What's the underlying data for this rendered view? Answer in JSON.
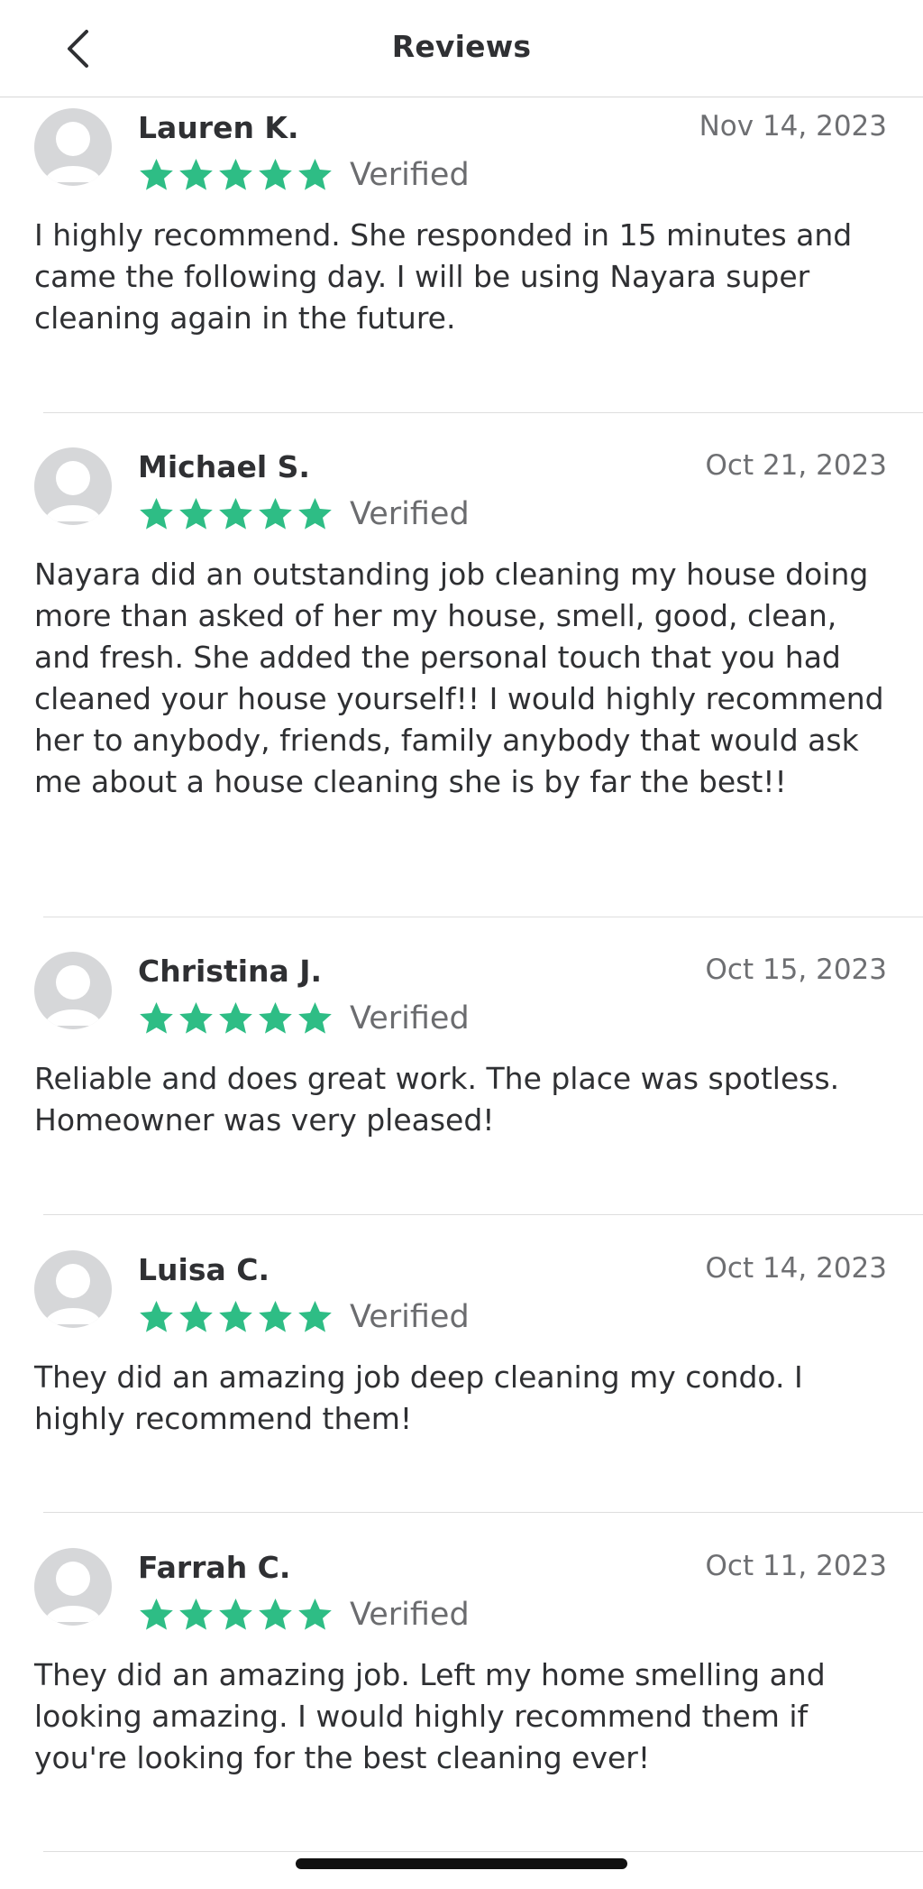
{
  "header": {
    "title": "Reviews"
  },
  "colors": {
    "star": "#2ebd85",
    "avatar": "#d6d7d9"
  },
  "reviews": [
    {
      "name": "Lauren K.",
      "date": "Nov 14, 2023",
      "rating": 5,
      "verified_label": "Verified",
      "text": "I highly recommend. She responded in 15 minutes and came the following day. I will be using Nayara super cleaning again in the future."
    },
    {
      "name": "Michael S.",
      "date": "Oct 21, 2023",
      "rating": 5,
      "verified_label": "Verified",
      "text": "Nayara did an outstanding job cleaning my house doing more than asked of her my house, smell, good, clean, and fresh. She added the personal touch that you had cleaned your house yourself!! I would highly recommend her to anybody, friends, family anybody that would ask me about a house cleaning she is by far the best!!"
    },
    {
      "name": "Christina J.",
      "date": "Oct 15, 2023",
      "rating": 5,
      "verified_label": "Verified",
      "text": "Reliable and does great work. The place was spotless. Homeowner was very pleased!"
    },
    {
      "name": "Luisa C.",
      "date": "Oct 14, 2023",
      "rating": 5,
      "verified_label": "Verified",
      "text": "They did an amazing job deep cleaning my condo. I highly recommend them!"
    },
    {
      "name": "Farrah C.",
      "date": "Oct 11, 2023",
      "rating": 5,
      "verified_label": "Verified",
      "text": "They did an amazing job. Left my home smelling and looking amazing. I would highly recommend them if you're looking for the best cleaning ever!"
    }
  ]
}
